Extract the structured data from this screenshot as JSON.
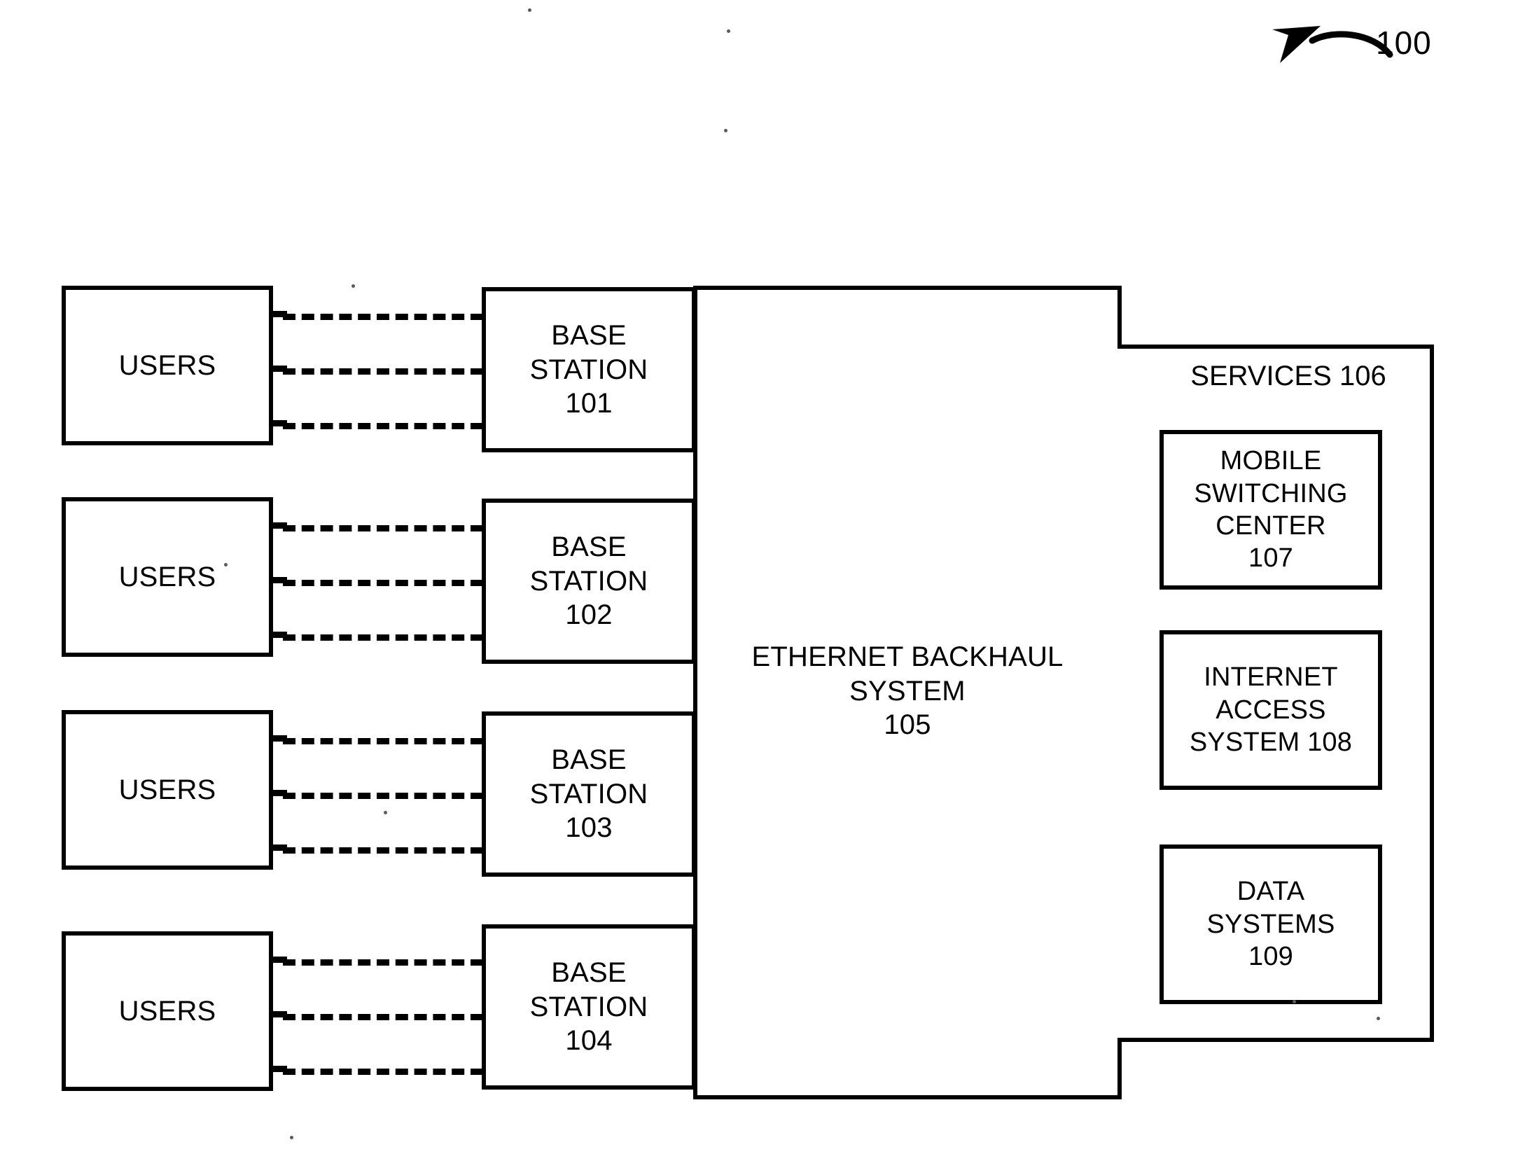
{
  "figure": {
    "reference_number": "100",
    "arrow_icon": "curved-arrow-left-icon"
  },
  "users": [
    {
      "label": "USERS"
    },
    {
      "label": "USERS"
    },
    {
      "label": "USERS"
    },
    {
      "label": "USERS"
    }
  ],
  "base_stations": [
    {
      "label": "BASE\nSTATION\n101",
      "number": "101"
    },
    {
      "label": "BASE\nSTATION\n102",
      "number": "102"
    },
    {
      "label": "BASE\nSTATION\n103",
      "number": "103"
    },
    {
      "label": "BASE\nSTATION\n104",
      "number": "104"
    }
  ],
  "backhaul": {
    "label": "ETHERNET BACKHAUL\nSYSTEM\n105",
    "number": "105"
  },
  "services": {
    "title": "SERVICES 106",
    "number": "106",
    "items": [
      {
        "label": "MOBILE\nSWITCHING\nCENTER\n107",
        "number": "107"
      },
      {
        "label": "INTERNET\nACCESS\nSYSTEM 108",
        "number": "108"
      },
      {
        "label": "DATA\nSYSTEMS\n109",
        "number": "109"
      }
    ]
  },
  "style": {
    "line_color": "#000000",
    "background_color": "#ffffff"
  }
}
